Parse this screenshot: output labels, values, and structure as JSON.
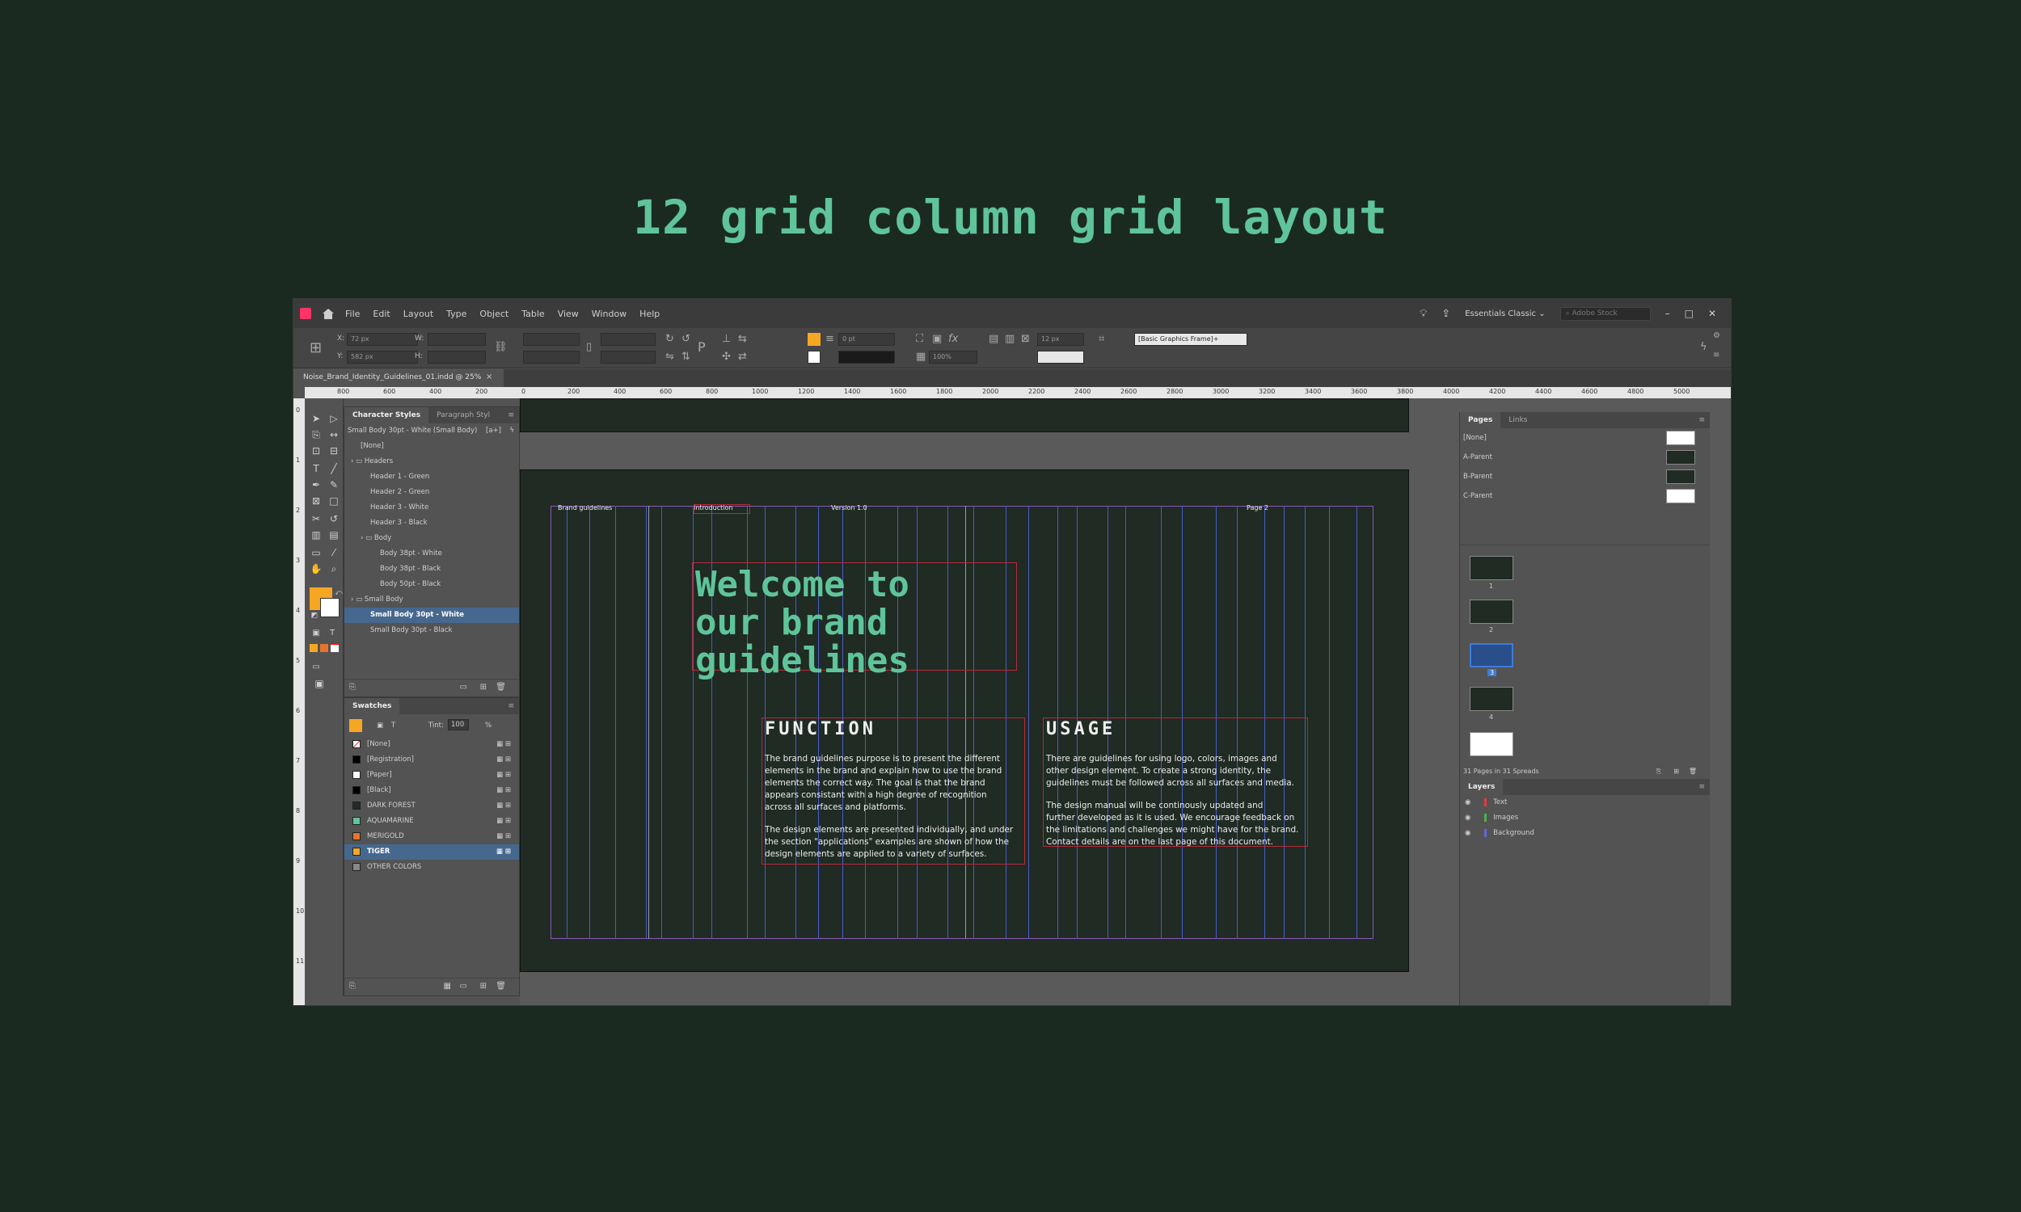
{
  "headline": "12 grid column grid layout",
  "menubar": {
    "items": [
      "File",
      "Edit",
      "Layout",
      "Type",
      "Object",
      "Table",
      "View",
      "Window",
      "Help"
    ],
    "workspace": "Essentials Classic",
    "search_placeholder": "Adobe Stock"
  },
  "control": {
    "x_label": "X:",
    "x_value": "72 px",
    "y_label": "Y:",
    "y_value": "582 px",
    "w_label": "W:",
    "h_label": "H:",
    "stroke_weight": "0 pt",
    "opacity": "100%",
    "spacing": "12 px",
    "frame_style": "[Basic Graphics Frame]+"
  },
  "doc_tab": {
    "title": "Noise_Brand_Identity_Guidelines_01.indd @ 25%",
    "close": "×"
  },
  "ruler_h": [
    "800",
    "600",
    "400",
    "200",
    "0",
    "200",
    "400",
    "600",
    "800",
    "1000",
    "1200",
    "1400",
    "1600",
    "1800",
    "2000",
    "2200",
    "2400",
    "2600",
    "2800",
    "3000",
    "3200",
    "3400",
    "3600",
    "3800",
    "4000",
    "4200",
    "4400",
    "4600",
    "4800",
    "5000"
  ],
  "ruler_v": [
    "0",
    "1",
    "2",
    "3",
    "4",
    "5",
    "6",
    "7",
    "8",
    "9",
    "10",
    "11"
  ],
  "char_styles": {
    "tabs": [
      "Character Styles",
      "Paragraph Styl"
    ],
    "current": "Small Body 30pt - White (Small Body)",
    "items": [
      {
        "label": "[None]",
        "indent": 1
      },
      {
        "label": "Headers",
        "indent": 0,
        "folder": true
      },
      {
        "label": "Header 1 - Green",
        "indent": 2
      },
      {
        "label": "Header 2 - Green",
        "indent": 2
      },
      {
        "label": "Header 3 - White",
        "indent": 2
      },
      {
        "label": "Header 3 - Black",
        "indent": 2
      },
      {
        "label": "Body",
        "indent": 1,
        "folder": true
      },
      {
        "label": "Body 38pt - White",
        "indent": 3
      },
      {
        "label": "Body 38pt - Black",
        "indent": 3
      },
      {
        "label": "Body 50pt - Black",
        "indent": 3
      },
      {
        "label": "Small Body",
        "indent": 0,
        "folder": true
      },
      {
        "label": "Small Body 30pt - White",
        "indent": 2,
        "selected": true
      },
      {
        "label": "Small Body 30pt - Black",
        "indent": 2
      }
    ]
  },
  "swatches": {
    "title": "Swatches",
    "tint_label": "Tint:",
    "tint_value": "100",
    "tint_unit": "%",
    "items": [
      {
        "label": "[None]",
        "color": "#ffffff",
        "none": true
      },
      {
        "label": "[Registration]",
        "color": "#000000"
      },
      {
        "label": "[Paper]",
        "color": "#ffffff"
      },
      {
        "label": "[Black]",
        "color": "#000000"
      },
      {
        "label": "DARK FOREST",
        "color": "#1f2b23"
      },
      {
        "label": "AQUAMARINE",
        "color": "#5fc49a"
      },
      {
        "label": "MERIGOLD",
        "color": "#e8742c"
      },
      {
        "label": "TIGER",
        "color": "#f5a623",
        "selected": true
      },
      {
        "label": "OTHER COLORS",
        "color": "#888888",
        "folder": true
      }
    ]
  },
  "document": {
    "labels": [
      "Brand guidelines",
      "Introduction",
      "Version 1.0",
      "Page 2"
    ],
    "welcome": [
      "Welcome to",
      "our brand",
      "guidelines"
    ],
    "function_title": "FUNCTION",
    "function_p1": [
      "The brand guidelines purpose is to present the different",
      "elements in the brand and explain how to use the brand",
      "elements the correct way. The goal is that the brand",
      "appears consistant with a high degree of recognition",
      "across all surfaces and platforms."
    ],
    "function_p2": [
      "The design elements are presented individually, and under",
      "the section \"applications\" examples are shown of how the",
      "design elements are applied to a variety of surfaces."
    ],
    "usage_title": "USAGE",
    "usage_p1": [
      "There are guidelines for using logo, colors, images and",
      "other design element. To create a strong identity, the",
      "guidelines must be followed across all surfaces and media."
    ],
    "usage_p2": [
      "The design manual will be continously updated and",
      "further developed as it is used. We encourage feedback on",
      "the limitations and challenges we might have for the brand.",
      "Contact details are on the last page of this document."
    ]
  },
  "pages_panel": {
    "tabs": [
      "Pages",
      "Links"
    ],
    "parents": [
      "[None]",
      "A-Parent",
      "B-Parent",
      "C-Parent"
    ],
    "thumb_numbers": [
      "1",
      "2",
      "3",
      "4"
    ],
    "summary": "31 Pages in 31 Spreads"
  },
  "layers_panel": {
    "title": "Layers",
    "items": [
      {
        "label": "Text",
        "color": "#e03b3b"
      },
      {
        "label": "Images",
        "color": "#4caf50"
      },
      {
        "label": "Background",
        "color": "#5a6ad9"
      }
    ]
  }
}
